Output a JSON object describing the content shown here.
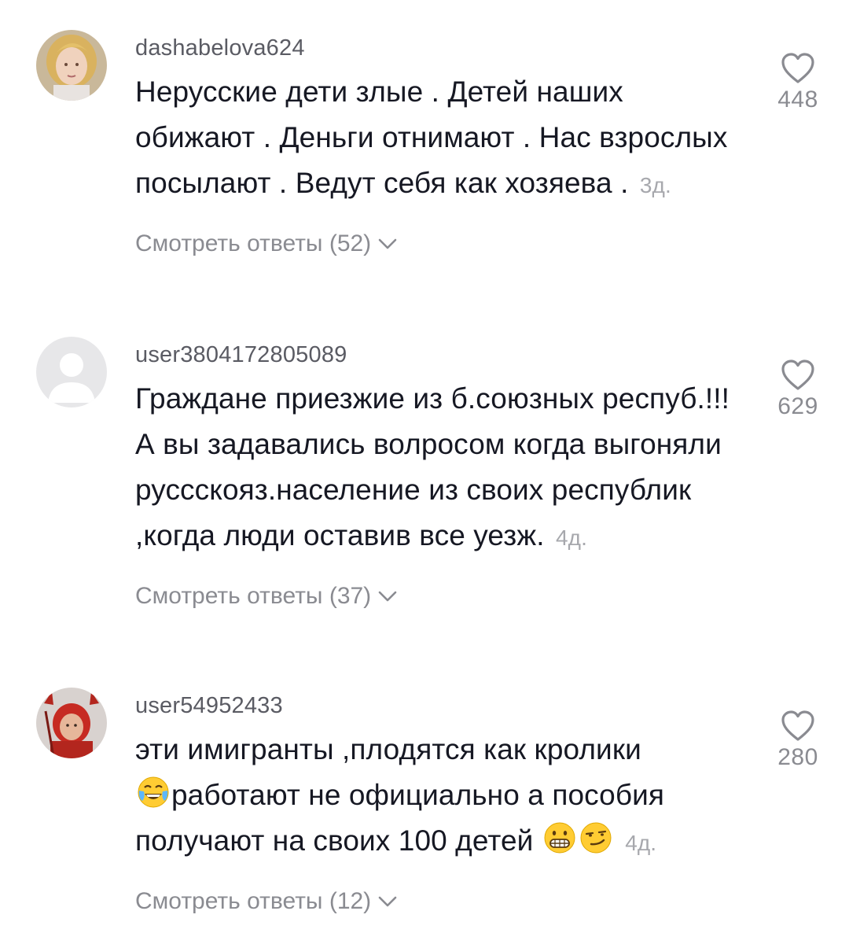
{
  "comments": [
    {
      "username": "dashabelova624",
      "text": "Нерусские дети злые . Детей наших обижают . Деньги отнимают . Нас взрослых посылают . Ведут себя как хозяева .",
      "time": "3д.",
      "replies_label": "Смотреть ответы (52)",
      "likes": "448"
    },
    {
      "username": "user3804172805089",
      "text": "Граждане приезжие из б.союзных респуб.!!!А вы задавались волросом когда выгоняли руссскояз.население из своих республик ,когда люди оставив все уезж.",
      "time": "4д.",
      "replies_label": "Смотреть ответы (37)",
      "likes": "629"
    },
    {
      "username": "user54952433",
      "text_line1": "эти имигранты ,плодятся как кролики",
      "text_line2": "работают не официально а пособия получают на своих 100 детей",
      "time": "4д.",
      "replies_label": "Смотреть ответы (12)",
      "likes": "280"
    }
  ],
  "icons": {
    "heart": "heart-outline-icon",
    "chevron": "chevron-down-icon",
    "emoji_laugh": "tears-of-joy-emoji",
    "emoji_grimace": "grimacing-emoji",
    "emoji_smirk": "smirking-emoji"
  },
  "colors": {
    "text": "#161823",
    "secondary": "#8a8b91",
    "username": "#5a5b63",
    "time": "#a7a8ad"
  }
}
